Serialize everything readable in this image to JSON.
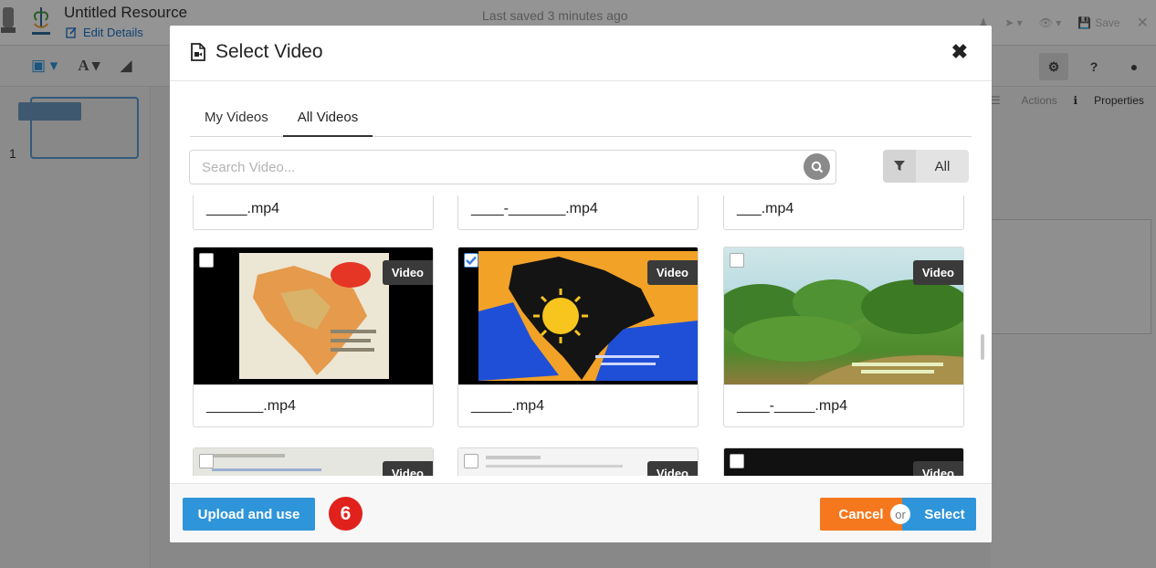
{
  "editor": {
    "title": "Untitled Resource",
    "edit_details": "Edit Details",
    "last_saved": "Last saved 3 minutes ago",
    "save_label": "Save",
    "slide_number": "1",
    "side_tabs": {
      "actions": "Actions",
      "properties": "Properties"
    }
  },
  "modal": {
    "title": "Select Video",
    "tabs": [
      {
        "label": "My Videos",
        "active": false
      },
      {
        "label": "All Videos",
        "active": true
      }
    ],
    "search_placeholder": "Search Video...",
    "filter_label": "All",
    "badge_label": "Video",
    "videos": [
      {
        "name": "_____.mp4",
        "checked": false
      },
      {
        "name": "____-_______.mp4",
        "checked": false
      },
      {
        "name": "___.mp4",
        "checked": false
      },
      {
        "name": "_______.mp4",
        "checked": false,
        "thumb": "india-map-orange"
      },
      {
        "name": "_____.mp4",
        "checked": true,
        "thumb": "india-map-sun"
      },
      {
        "name": "____-_____.mp4",
        "checked": false,
        "thumb": "forest-landscape"
      },
      {
        "checked": false
      },
      {
        "checked": false
      },
      {
        "checked": false
      }
    ],
    "footer": {
      "upload_label": "Upload and use",
      "step_number": "6",
      "cancel_label": "Cancel",
      "or_label": "or",
      "select_label": "Select"
    }
  },
  "colors": {
    "primary": "#2f95da",
    "cancel": "#f5781e",
    "step_badge": "#e0211c"
  }
}
